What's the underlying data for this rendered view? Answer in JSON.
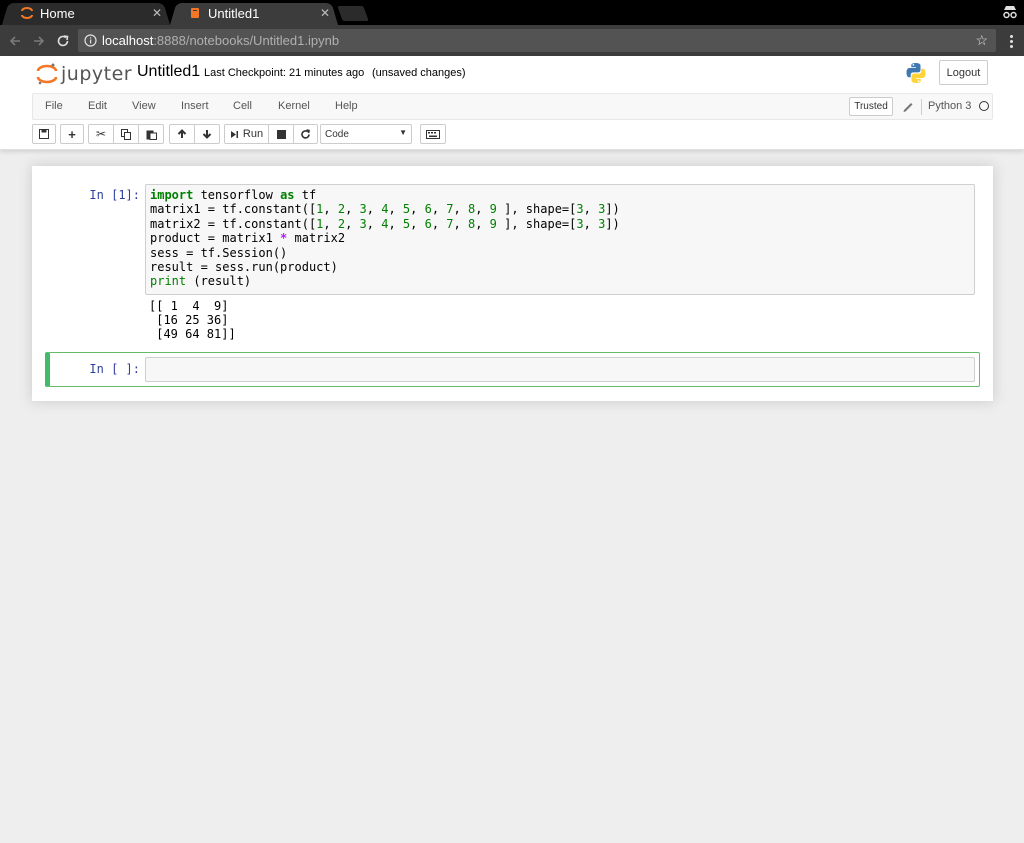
{
  "browser": {
    "tabs": [
      {
        "label": "Home",
        "active": false
      },
      {
        "label": "Untitled1",
        "active": true
      }
    ],
    "url_host": "localhost",
    "url_path": ":8888/notebooks/Untitled1.ipynb"
  },
  "header": {
    "logo_text": "jupyter",
    "notebook_title": "Untitled1",
    "checkpoint": "Last Checkpoint: 21 minutes ago",
    "unsaved": "(unsaved changes)",
    "logout_label": "Logout"
  },
  "menubar": {
    "items": [
      "File",
      "Edit",
      "View",
      "Insert",
      "Cell",
      "Kernel",
      "Help"
    ],
    "trusted_label": "Trusted",
    "kernel_name": "Python 3"
  },
  "toolbar": {
    "run_label": "Run",
    "cell_type": "Code"
  },
  "cells": [
    {
      "prompt": "In [1]:",
      "code": [
        "import tensorflow as tf",
        "matrix1 = tf.constant([1, 2, 3, 4, 5, 6, 7, 8, 9 ], shape=[3, 3])",
        "matrix2 = tf.constant([1, 2, 3, 4, 5, 6, 7, 8, 9 ], shape=[3, 3])",
        "product = matrix1 * matrix2",
        "sess = tf.Session()",
        "result = sess.run(product)",
        "print (result)"
      ],
      "output": [
        "[[ 1  4  9]",
        " [16 25 36]",
        " [49 64 81]]"
      ]
    },
    {
      "prompt": "In [ ]:",
      "code": [],
      "output": []
    }
  ],
  "colors": {
    "prompt": "#303f9f",
    "keyword": "#008000",
    "operator": "#aa22ff",
    "selected_cell_border": "#66bb6a"
  }
}
